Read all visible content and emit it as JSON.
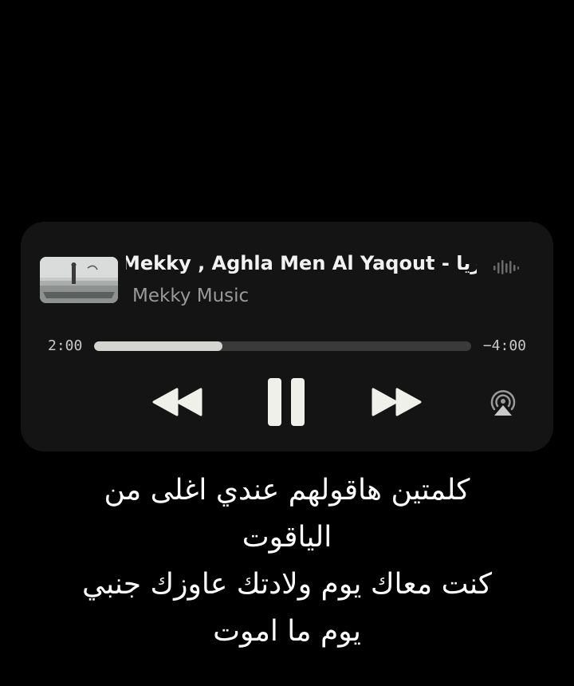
{
  "player": {
    "title": "Mekky , Aghla Men Al Yaqout - عمريا",
    "artist": "Mekky Music",
    "elapsed": "2:00",
    "remaining": "−4:00",
    "progress": 0.34,
    "icons": {
      "artwork": "album-artwork",
      "waveform": "audio-waveform-icon",
      "rewind": "rewind-icon",
      "pause": "pause-icon",
      "forward": "fast-forward-icon",
      "airplay": "airplay-icon"
    }
  },
  "lyrics": [
    "كلمتين هاقولهم عندي اغلى من",
    "الياقوت",
    "كنت معاك يوم ولادتك عاوزك جنبي",
    "يوم ما اموت"
  ]
}
